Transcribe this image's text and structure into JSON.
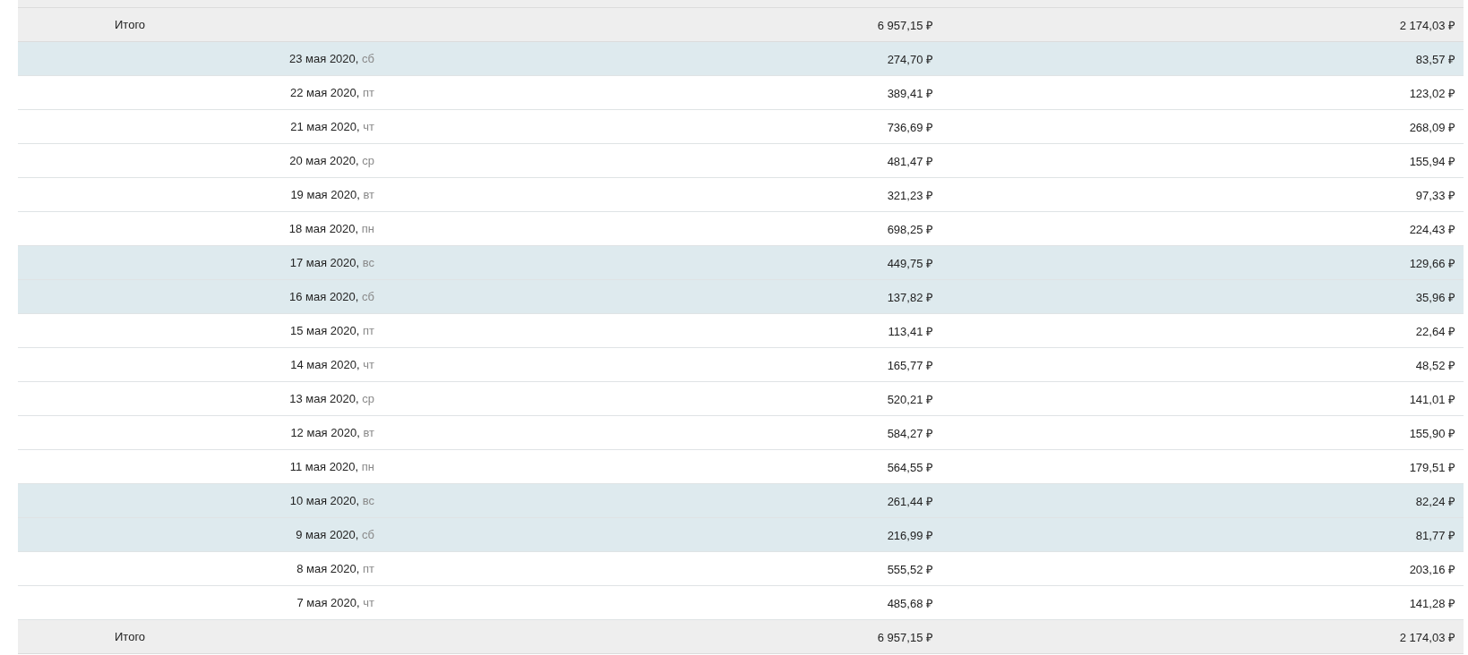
{
  "table": {
    "total_top": {
      "label": "Итого",
      "column_2": "6 957,15 ₽",
      "column_3": "2 174,03 ₽"
    },
    "rows": [
      {
        "date": "23 мая 2020,",
        "weekday": "сб",
        "weekend": true,
        "column_2": "274,70 ₽",
        "column_3": "83,57 ₽"
      },
      {
        "date": "22 мая 2020,",
        "weekday": "пт",
        "weekend": false,
        "column_2": "389,41 ₽",
        "column_3": "123,02 ₽"
      },
      {
        "date": "21 мая 2020,",
        "weekday": "чт",
        "weekend": false,
        "column_2": "736,69 ₽",
        "column_3": "268,09 ₽"
      },
      {
        "date": "20 мая 2020,",
        "weekday": "ср",
        "weekend": false,
        "column_2": "481,47 ₽",
        "column_3": "155,94 ₽"
      },
      {
        "date": "19 мая 2020,",
        "weekday": "вт",
        "weekend": false,
        "column_2": "321,23 ₽",
        "column_3": "97,33 ₽"
      },
      {
        "date": "18 мая 2020,",
        "weekday": "пн",
        "weekend": false,
        "column_2": "698,25 ₽",
        "column_3": "224,43 ₽"
      },
      {
        "date": "17 мая 2020,",
        "weekday": "вс",
        "weekend": true,
        "column_2": "449,75 ₽",
        "column_3": "129,66 ₽"
      },
      {
        "date": "16 мая 2020,",
        "weekday": "сб",
        "weekend": true,
        "column_2": "137,82 ₽",
        "column_3": "35,96 ₽"
      },
      {
        "date": "15 мая 2020,",
        "weekday": "пт",
        "weekend": false,
        "column_2": "113,41 ₽",
        "column_3": "22,64 ₽"
      },
      {
        "date": "14 мая 2020,",
        "weekday": "чт",
        "weekend": false,
        "column_2": "165,77 ₽",
        "column_3": "48,52 ₽"
      },
      {
        "date": "13 мая 2020,",
        "weekday": "ср",
        "weekend": false,
        "column_2": "520,21 ₽",
        "column_3": "141,01 ₽"
      },
      {
        "date": "12 мая 2020,",
        "weekday": "вт",
        "weekend": false,
        "column_2": "584,27 ₽",
        "column_3": "155,90 ₽"
      },
      {
        "date": "11 мая 2020,",
        "weekday": "пн",
        "weekend": false,
        "column_2": "564,55 ₽",
        "column_3": "179,51 ₽"
      },
      {
        "date": "10 мая 2020,",
        "weekday": "вс",
        "weekend": true,
        "column_2": "261,44 ₽",
        "column_3": "82,24 ₽"
      },
      {
        "date": "9 мая 2020,",
        "weekday": "сб",
        "weekend": true,
        "column_2": "216,99 ₽",
        "column_3": "81,77 ₽"
      },
      {
        "date": "8 мая 2020,",
        "weekday": "пт",
        "weekend": false,
        "column_2": "555,52 ₽",
        "column_3": "203,16 ₽"
      },
      {
        "date": "7 мая 2020,",
        "weekday": "чт",
        "weekend": false,
        "column_2": "485,68 ₽",
        "column_3": "141,28 ₽"
      }
    ],
    "total_bottom": {
      "label": "Итого",
      "column_2": "6 957,15 ₽",
      "column_3": "2 174,03 ₽"
    }
  }
}
